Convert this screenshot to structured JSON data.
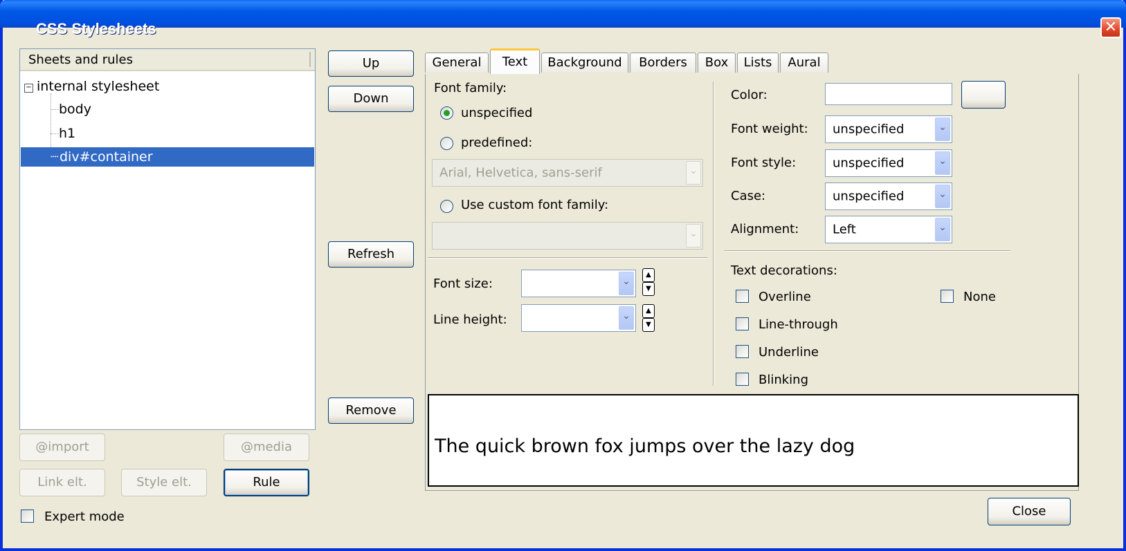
{
  "window": {
    "title": "CSS Stylesheets",
    "close_glyph": "✕"
  },
  "tree": {
    "header": "Sheets and rules",
    "nodes": [
      {
        "label": "internal stylesheet",
        "expander": "−"
      },
      {
        "label": "body"
      },
      {
        "label": "h1"
      },
      {
        "label": "div#container",
        "selected": true
      }
    ]
  },
  "left_buttons": {
    "import": "@import",
    "media": "@media",
    "link": "Link elt.",
    "style": "Style elt.",
    "rule": "Rule"
  },
  "expert_mode": {
    "label": "Expert mode",
    "checked": false
  },
  "mid_buttons": {
    "up": "Up",
    "down": "Down",
    "refresh": "Refresh",
    "remove": "Remove"
  },
  "tabs": [
    "General",
    "Text",
    "Background",
    "Borders",
    "Box",
    "Lists",
    "Aural"
  ],
  "active_tab": "Text",
  "font_family": {
    "label": "Font family:",
    "unspecified": "unspecified",
    "predefined": "predefined:",
    "predefined_value": "Arial, Helvetica, sans-serif",
    "custom": "Use custom font family:",
    "custom_value": ""
  },
  "font_size": {
    "label": "Font size:",
    "value": ""
  },
  "line_height": {
    "label": "Line height:",
    "value": ""
  },
  "color": {
    "label": "Color:",
    "value": ""
  },
  "font_weight": {
    "label": "Font weight:",
    "value": "unspecified"
  },
  "font_style": {
    "label": "Font style:",
    "value": "unspecified"
  },
  "case": {
    "label": "Case:",
    "value": "unspecified"
  },
  "alignment": {
    "label": "Alignment:",
    "value": "Left"
  },
  "decorations": {
    "label": "Text decorations:",
    "overline": "Overline",
    "line_through": "Line-through",
    "underline": "Underline",
    "blinking": "Blinking",
    "none": "None"
  },
  "preview_text": "The quick brown fox jumps over the lazy dog",
  "close_button": "Close",
  "icons": {
    "arrow": "chevron-down-icon",
    "spin_up": "▲",
    "spin_down": "▼"
  },
  "colors": {
    "title_bar": "#0054e3",
    "selection": "#316ac5",
    "active_tab_accent": "#ffc83c",
    "dialog_bg": "#ece9d8"
  }
}
